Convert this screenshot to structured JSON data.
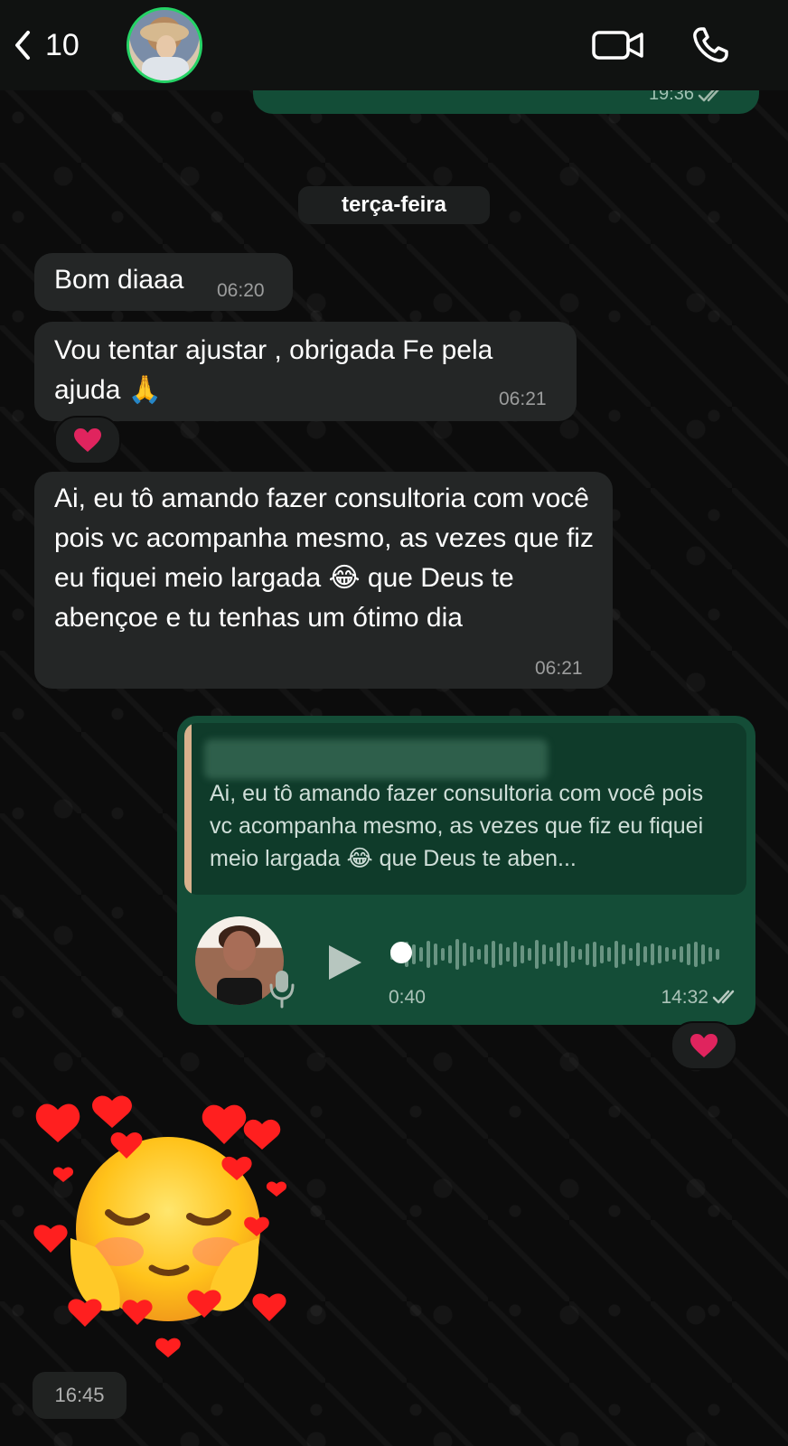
{
  "header": {
    "back_count": "10",
    "contact_avatar_icon": "contact-avatar",
    "video_icon": "video-camera-icon",
    "call_icon": "phone-icon"
  },
  "previous_message": {
    "time": "19:36"
  },
  "chat": {
    "day_label": "terça-feira",
    "messages": [
      {
        "text": "Bom diaaa",
        "time": "06:20"
      },
      {
        "text": "Vou tentar ajustar , obrigada Fe pela ajuda 🙏",
        "time": "06:21",
        "reaction": "❤️"
      },
      {
        "text": "Ai, eu tô amando fazer consultoria com você pois vc acompanha mesmo, as vezes que fiz eu fiquei meio largada 😂 que Deus te abençoe e tu tenhas um ótimo dia",
        "time": "06:21"
      }
    ],
    "voice_message": {
      "quoted_text": "Ai, eu tô amando fazer consultoria com você pois vc acompanha mesmo, as vezes que fiz eu fiquei meio largada 😂 que Deus te aben...",
      "duration": "0:40",
      "time": "14:32",
      "reaction": "❤️",
      "play_icon": "play-icon",
      "mic_icon": "microphone-icon"
    },
    "sticker": {
      "time": "16:45",
      "description": "blushing face sticker with hearts"
    }
  },
  "colors": {
    "header_bg": "#101211",
    "incoming_bubble": "#242626",
    "outgoing_bubble": "#144d37",
    "avatar_ring": "#25d366",
    "reaction_heart": "#e0245e"
  }
}
